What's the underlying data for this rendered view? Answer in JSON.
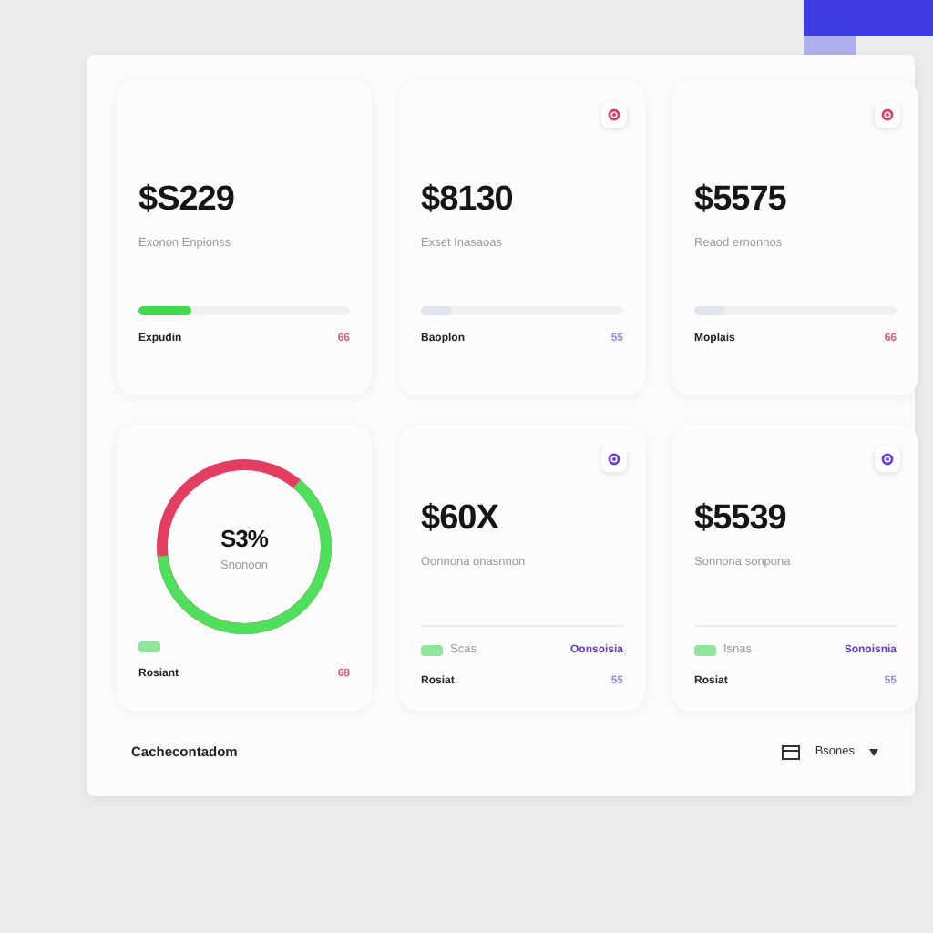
{
  "cards": [
    {
      "kind": "stat",
      "value": "$S229",
      "subtitle": "Exonon Enpionss",
      "bar": {
        "level": 0.25,
        "active": true
      },
      "footer_label": "Expudin",
      "footer_value": "66",
      "alert": true
    },
    {
      "kind": "stat",
      "badge": {
        "color": "#d8405e"
      },
      "value": "$8130",
      "subtitle": "Exset Inasaoas",
      "bar": {
        "level": 0.15,
        "active": false
      },
      "footer_label": "Baoplon",
      "footer_value": "55",
      "alert": false
    },
    {
      "kind": "stat",
      "badge": {
        "color": "#d8405e"
      },
      "value": "$5575",
      "subtitle": "Reaod ernonnos",
      "bar": {
        "level": 0.15,
        "active": false
      },
      "footer_label": "Moplais",
      "footer_value": "66",
      "alert": true
    },
    {
      "kind": "donut",
      "value": "S3%",
      "subtitle": "Snonoon",
      "swatch": true,
      "footer_label": "Rosiant",
      "footer_value": "68",
      "alert": true
    },
    {
      "kind": "stat",
      "badge": {
        "color": "#6a3fd8"
      },
      "value": "$60X",
      "subtitle": "Oonnona onasnnon",
      "legend": {
        "text": "Scas",
        "link": "Oonsoisia"
      },
      "footer_label": "Rosiat",
      "footer_value": "55",
      "alert": false
    },
    {
      "kind": "stat",
      "badge": {
        "color": "#6a3fd8"
      },
      "value": "$5539",
      "subtitle": "Sonnona sonpona",
      "legend": {
        "text": "Isnas",
        "link": "Sonoisnia"
      },
      "footer_label": "Rosiat",
      "footer_value": "55",
      "alert": false
    }
  ],
  "footer": {
    "title": "Cachecontadom",
    "menu_label": "Bsones"
  }
}
